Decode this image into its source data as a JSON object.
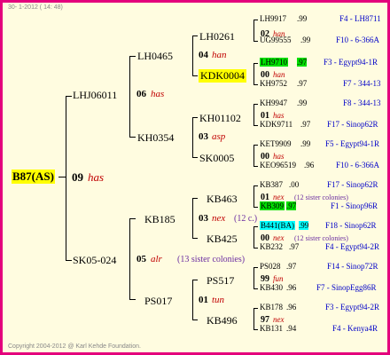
{
  "header": {
    "date": "30-  1-2012 ( 14: 48)"
  },
  "footer": {
    "copyright": "Copyright 2004-2012 @ Karl Kehde Foundation."
  },
  "colors": {
    "border": "#e4007c",
    "background": "#fffce0",
    "queen_line": "#c00000",
    "location": "#0000c8",
    "sister_note": "#6a2ca0",
    "hl_yellow": "#ffff00",
    "hl_green": "#00e000",
    "hl_cyan": "#00ffff"
  },
  "root": {
    "name": "B87(AS)",
    "year": "09",
    "queen": "has"
  },
  "level1": [
    {
      "name": "LHJ06011",
      "year": "06",
      "queen": "has"
    },
    {
      "name": "SK05-024",
      "year": "05",
      "queen": "alr",
      "note": "(13 sister colonies)"
    }
  ],
  "level2": [
    {
      "name": "LH0465",
      "year": "04",
      "queen": "han"
    },
    {
      "name": "KH0354",
      "year": "03",
      "queen": "asp"
    },
    {
      "name": "KB185",
      "year": "03",
      "queen": "nex",
      "note": "(12 c.)"
    },
    {
      "name": "PS017",
      "year": "01",
      "queen": "tun"
    }
  ],
  "level3": [
    {
      "name": "LH0261",
      "year": "02",
      "queen": "han"
    },
    {
      "name": "KDK0004",
      "year": "00",
      "queen": "han"
    },
    {
      "name": "KH01102",
      "year": "01",
      "queen": "has"
    },
    {
      "name": "SK0005",
      "year": "00",
      "queen": "has"
    },
    {
      "name": "KB463",
      "year": "01",
      "queen": "nex",
      "note": "(12 sister colonies)"
    },
    {
      "name": "KB425",
      "year": "00",
      "queen": "nex",
      "note": "(12 sister colonies)"
    },
    {
      "name": "PS517",
      "year": "99",
      "queen": "fun"
    },
    {
      "name": "KB496",
      "year": "97",
      "queen": "nex"
    }
  ],
  "leaves": [
    {
      "name": "LH9917",
      "year": ".99",
      "loc": "F4 - LH8711"
    },
    {
      "name": "UG99555",
      "year": ".99",
      "loc": "F10 - 6-366A"
    },
    {
      "name": "LH9710",
      "year": ".97",
      "loc": "F3 - Egypt94-1R"
    },
    {
      "name": "KH9752",
      "year": ".97",
      "loc": "F7 - 344-13"
    },
    {
      "name": "KH9947",
      "year": ".99",
      "loc": "F8 - 344-13"
    },
    {
      "name": "KDK9711",
      "year": ".97",
      "loc": "F17 - Sinop62R"
    },
    {
      "name": "KET9909",
      "year": ".99",
      "loc": "F5 - Egypt94-1R"
    },
    {
      "name": "KEO96519",
      "year": ".96",
      "loc": "F10 - 6-366A"
    },
    {
      "name": "KB387",
      "year": ".00",
      "loc": "F17 - Sinop62R"
    },
    {
      "name": "KB309",
      "year": ".97",
      "loc": "F1 - Sinop96R"
    },
    {
      "name": "B441(BA)",
      "year": ".99",
      "loc": "F18 - Sinop62R"
    },
    {
      "name": "KB232",
      "year": ".97",
      "loc": "F4 - Egypt94-2R"
    },
    {
      "name": "PS028",
      "year": ".97",
      "loc": "F14 - Sinop72R"
    },
    {
      "name": "KB430",
      "year": ".96",
      "loc": "F7 - SinopEgg86R"
    },
    {
      "name": "KB178",
      "year": ".96",
      "loc": "F3 - Egypt94-2R"
    },
    {
      "name": "KB131",
      "year": ".94",
      "loc": "F4 - Kenya4R"
    }
  ]
}
